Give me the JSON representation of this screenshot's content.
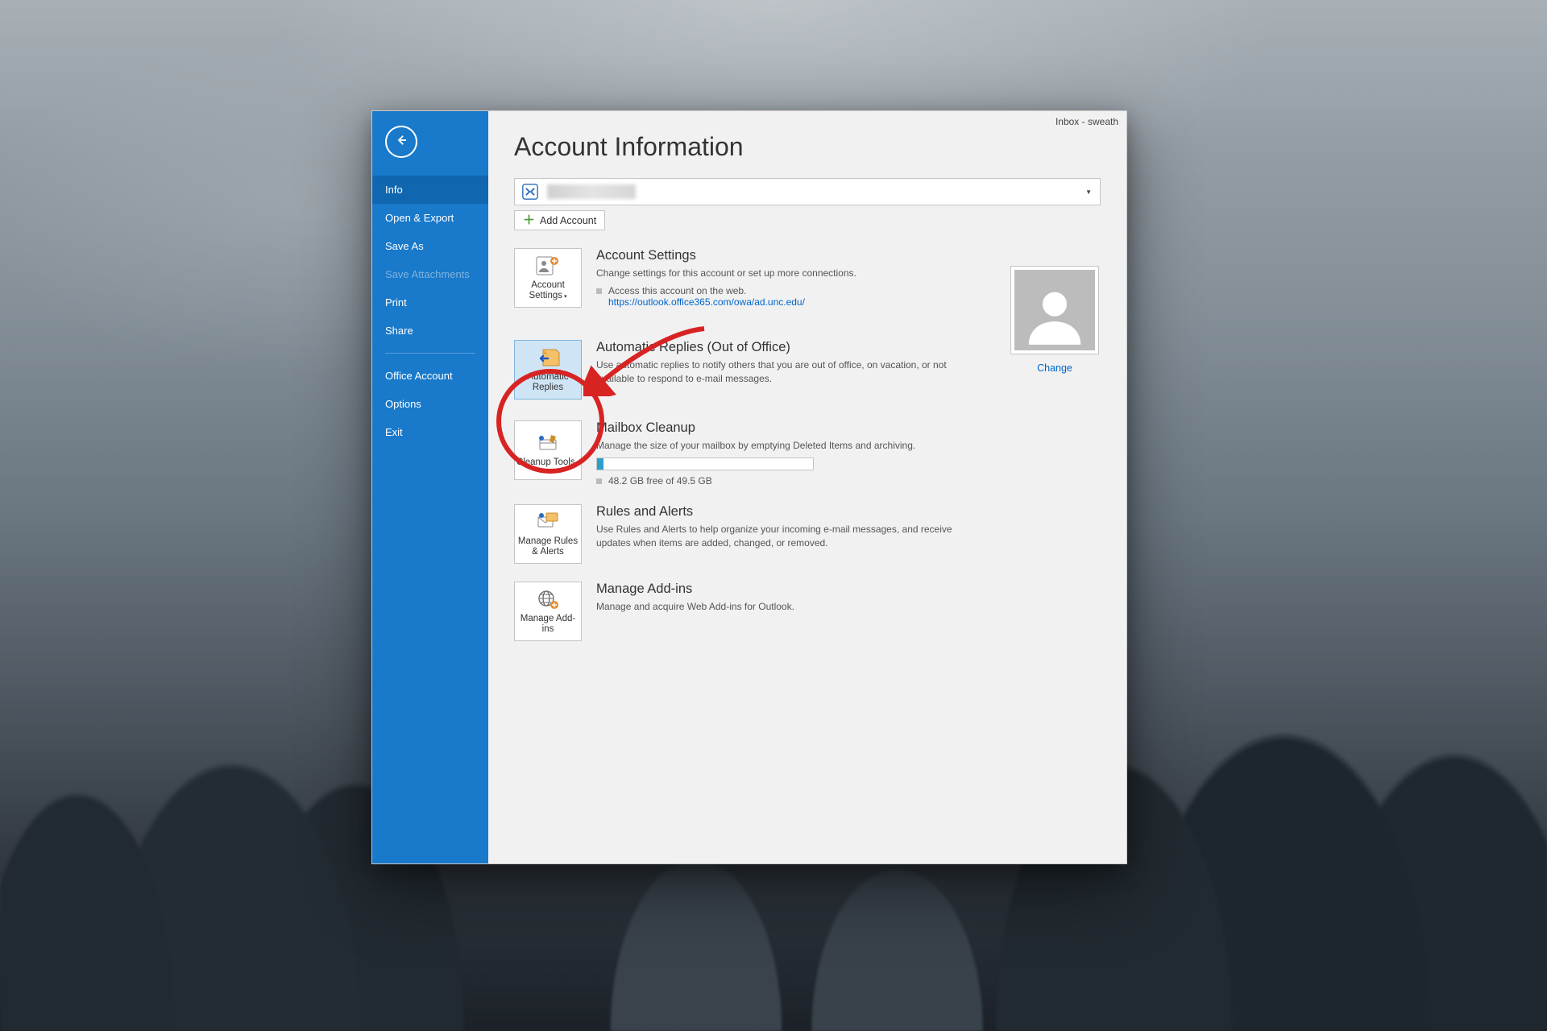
{
  "titlebar": {
    "text": "Inbox - sweath"
  },
  "sidebar": {
    "items": [
      {
        "label": "Info",
        "active": true
      },
      {
        "label": "Open & Export"
      },
      {
        "label": "Save As"
      },
      {
        "label": "Save Attachments",
        "disabled": true
      },
      {
        "label": "Print"
      },
      {
        "label": "Share"
      }
    ],
    "lower": [
      {
        "label": "Office Account"
      },
      {
        "label": "Options"
      },
      {
        "label": "Exit"
      }
    ]
  },
  "page": {
    "title": "Account Information",
    "add_account": "Add Account",
    "avatar_change": "Change"
  },
  "sections": {
    "account_settings": {
      "tile": "Account Settings",
      "title": "Account Settings",
      "desc": "Change settings for this account or set up more connections.",
      "bullet": "Access this account on the web.",
      "url": "https://outlook.office365.com/owa/ad.unc.edu/"
    },
    "auto_replies": {
      "tile": "Automatic Replies",
      "title": "Automatic Replies (Out of Office)",
      "desc": "Use automatic replies to notify others that you are out of office, on vacation, or not available to respond to e-mail messages."
    },
    "mailbox_cleanup": {
      "tile": "Cleanup Tools",
      "title": "Mailbox Cleanup",
      "desc": "Manage the size of your mailbox by emptying Deleted Items and archiving.",
      "quota": "48.2 GB free of 49.5 GB"
    },
    "rules": {
      "tile": "Manage Rules & Alerts",
      "title": "Rules and Alerts",
      "desc": "Use Rules and Alerts to help organize your incoming e-mail messages, and receive updates when items are added, changed, or removed."
    },
    "addins": {
      "tile": "Manage Add-ins",
      "title": "Manage Add-ins",
      "desc": "Manage and acquire Web Add-ins for Outlook."
    }
  }
}
